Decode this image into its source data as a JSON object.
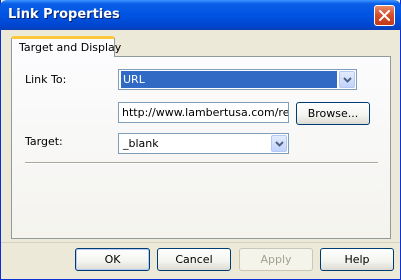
{
  "window": {
    "title": "Link Properties"
  },
  "tabs": [
    {
      "label": "Target and Display"
    }
  ],
  "form": {
    "link_to_label": "Link To:",
    "link_to_value": "URL",
    "url_value": "http://www.lambertusa.com/resou",
    "browse_label": "Browse...",
    "target_label": "Target:",
    "target_value": "_blank"
  },
  "buttons": {
    "ok": "OK",
    "cancel": "Cancel",
    "apply": "Apply",
    "help": "Help"
  },
  "colors": {
    "titlebar": "#0054e3",
    "selection": "#316ac5",
    "dialog_bg": "#ece9d8",
    "tab_highlight": "#ffc83c"
  }
}
